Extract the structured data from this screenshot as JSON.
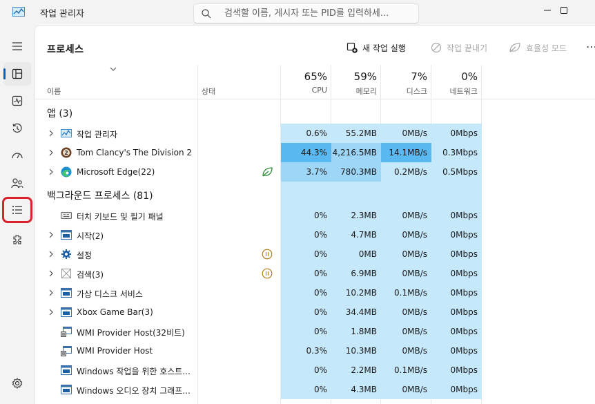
{
  "app": {
    "title": "작업 관리자"
  },
  "search": {
    "placeholder": "검색할 이름, 게시자 또는 PID를 입력하세..."
  },
  "toolbar": {
    "page_title": "프로세스",
    "run_new_task": "새 작업 실행",
    "end_task": "작업 끝내기",
    "efficiency_mode": "효율성 모드",
    "more": "⋯"
  },
  "headers": {
    "name": "이름",
    "status": "상태",
    "cpu_pct": "65%",
    "cpu": "CPU",
    "mem_pct": "59%",
    "mem": "메모리",
    "disk_pct": "7%",
    "disk": "디스크",
    "net_pct": "0%",
    "net": "네트워크"
  },
  "groups": {
    "apps": "앱 (3)",
    "background": "백그라운드 프로세스 (81)"
  },
  "apps": [
    {
      "name": "작업 관리자",
      "icon": "task-manager-icon",
      "status": "",
      "cpu": "0.6%",
      "mem": "55.2MB",
      "disk": "0MB/s",
      "net": "0Mbps"
    },
    {
      "name": "Tom Clancy's The Division 2",
      "icon": "division2-icon",
      "status": "",
      "cpu": "44.3%",
      "mem": "4,216.5MB",
      "disk": "14.1MB/s",
      "net": "0.3Mbps"
    },
    {
      "name": "Microsoft Edge(22)",
      "icon": "edge-icon",
      "status": "efficiency-leaf-icon",
      "cpu": "3.7%",
      "mem": "780.3MB",
      "disk": "0.2MB/s",
      "net": "0.5Mbps"
    }
  ],
  "background": [
    {
      "name": "터치 키보드 및 필기 패널",
      "icon": "keyboard-icon",
      "expand": false,
      "status": "",
      "cpu": "0%",
      "mem": "2.3MB",
      "disk": "0MB/s",
      "net": "0Mbps"
    },
    {
      "name": "시작(2)",
      "icon": "window-icon",
      "expand": true,
      "status": "",
      "cpu": "0%",
      "mem": "4.7MB",
      "disk": "0MB/s",
      "net": "0Mbps"
    },
    {
      "name": "설정",
      "icon": "gear-icon",
      "expand": true,
      "status": "paused-icon",
      "cpu": "0%",
      "mem": "0MB",
      "disk": "0MB/s",
      "net": "0Mbps"
    },
    {
      "name": "검색(3)",
      "icon": "placeholder-icon",
      "expand": true,
      "status": "paused-icon",
      "cpu": "0%",
      "mem": "6.9MB",
      "disk": "0MB/s",
      "net": "0Mbps"
    },
    {
      "name": "가상 디스크 서비스",
      "icon": "window-icon",
      "expand": true,
      "status": "",
      "cpu": "0%",
      "mem": "10.2MB",
      "disk": "0.1MB/s",
      "net": "0Mbps"
    },
    {
      "name": "Xbox Game Bar(3)",
      "icon": "window-icon",
      "expand": true,
      "status": "",
      "cpu": "0%",
      "mem": "34.4MB",
      "disk": "0MB/s",
      "net": "0Mbps"
    },
    {
      "name": "WMI Provider Host(32비트)",
      "icon": "wmi-icon",
      "expand": false,
      "status": "",
      "cpu": "0%",
      "mem": "1.8MB",
      "disk": "0MB/s",
      "net": "0Mbps"
    },
    {
      "name": "WMI Provider Host",
      "icon": "wmi-icon",
      "expand": false,
      "status": "",
      "cpu": "0.3%",
      "mem": "10.3MB",
      "disk": "0MB/s",
      "net": "0Mbps"
    },
    {
      "name": "Windows 작업을 위한 호스트...",
      "icon": "window-icon",
      "expand": false,
      "status": "",
      "cpu": "0%",
      "mem": "2.2MB",
      "disk": "0.1MB/s",
      "net": "0Mbps"
    },
    {
      "name": "Windows 오디오 장치 그래프...",
      "icon": "window-icon",
      "expand": false,
      "status": "",
      "cpu": "0%",
      "mem": "4.3MB",
      "disk": "0MB/s",
      "net": "0Mbps"
    }
  ],
  "colors": {
    "heat_low": "#c5e8fb",
    "heat_mid": "#9dd6f7",
    "heat_high": "#5ab9f0",
    "accent": "#005fb8",
    "highlight_ring": "#d8222c"
  },
  "sidebar": [
    {
      "name": "nav-processes",
      "icon": "processes-icon"
    },
    {
      "name": "nav-performance",
      "icon": "performance-icon"
    },
    {
      "name": "nav-app-history",
      "icon": "history-icon"
    },
    {
      "name": "nav-startup-apps",
      "icon": "startup-icon"
    },
    {
      "name": "nav-users",
      "icon": "users-icon"
    },
    {
      "name": "nav-details",
      "icon": "details-icon"
    },
    {
      "name": "nav-services",
      "icon": "services-icon"
    },
    {
      "name": "nav-settings",
      "icon": "settings-icon"
    }
  ]
}
